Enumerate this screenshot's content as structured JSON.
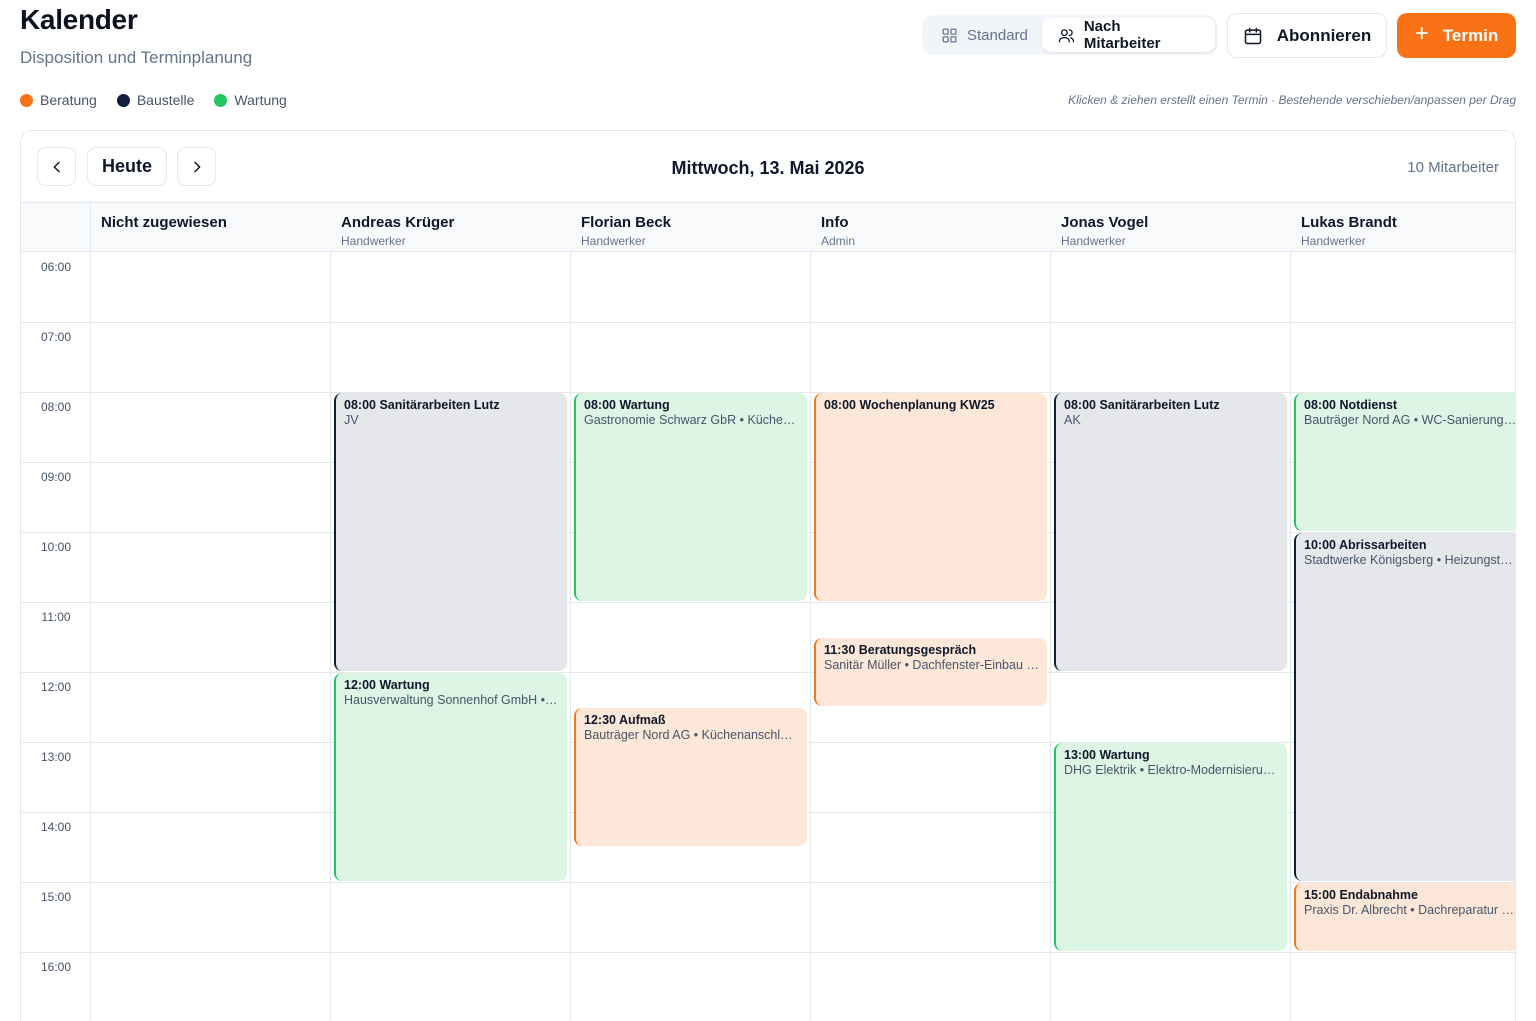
{
  "header": {
    "title": "Kalender",
    "subtitle": "Disposition und Terminplanung"
  },
  "view_toggle": {
    "standard_label": "Standard",
    "by_employee_label": "Nach Mitarbeiter",
    "active": "Nach Mitarbeiter"
  },
  "actions": {
    "subscribe_label": "Abonnieren",
    "new_label": "Termin"
  },
  "legend": [
    {
      "label": "Beratung",
      "color": "#f97316"
    },
    {
      "label": "Baustelle",
      "color": "#0f1f3d"
    },
    {
      "label": "Wartung",
      "color": "#22c55e"
    }
  ],
  "hint": "Klicken & ziehen erstellt einen Termin · Bestehende verschieben/anpassen per Drag",
  "calendar": {
    "today_label": "Heute",
    "date": "Mittwoch, 13. Mai 2026",
    "employee_count": "10 Mitarbeiter",
    "hours": [
      "06:00",
      "07:00",
      "08:00",
      "09:00",
      "10:00",
      "11:00",
      "12:00",
      "13:00",
      "14:00",
      "15:00",
      "16:00"
    ],
    "columns": [
      {
        "name": "Nicht zugewiesen",
        "role": ""
      },
      {
        "name": "Andreas Krüger",
        "role": "Handwerker"
      },
      {
        "name": "Florian Beck",
        "role": "Handwerker"
      },
      {
        "name": "Info",
        "role": "Admin"
      },
      {
        "name": "Jonas Vogel",
        "role": "Handwerker"
      },
      {
        "name": "Lukas Brandt",
        "role": "Handwerker"
      }
    ],
    "events": [
      {
        "column": 1,
        "start": 8,
        "end": 12,
        "type": "baustelle",
        "title": "08:00 Sanitärarbeiten Lutz",
        "subtitle": "JV"
      },
      {
        "column": 1,
        "start": 12,
        "end": 15,
        "type": "wartung",
        "title": "12:00 Wartung",
        "subtitle": "Hausverwaltung Sonnenhof GmbH • …"
      },
      {
        "column": 2,
        "start": 8,
        "end": 11,
        "type": "wartung",
        "title": "08:00 Wartung",
        "subtitle": "Gastronomie Schwarz GbR • Küchena…"
      },
      {
        "column": 2,
        "start": 12.5,
        "end": 14.5,
        "type": "beratung",
        "title": "12:30 Aufmaß",
        "subtitle": "Bauträger Nord AG • Küchenanschlus…"
      },
      {
        "column": 3,
        "start": 8,
        "end": 11,
        "type": "beratung",
        "title": "08:00 Wochenplanung KW25",
        "subtitle": ""
      },
      {
        "column": 3,
        "start": 11.5,
        "end": 12.5,
        "type": "beratung",
        "title": "11:30 Beratungsgespräch",
        "subtitle": "Sanitär Müller • Dachfenster-Einbau S…"
      },
      {
        "column": 4,
        "start": 8,
        "end": 12,
        "type": "baustelle",
        "title": "08:00 Sanitärarbeiten Lutz",
        "subtitle": "AK"
      },
      {
        "column": 4,
        "start": 13,
        "end": 16,
        "type": "wartung",
        "title": "13:00 Wartung",
        "subtitle": "DHG Elektrik • Elektro-Modernisierun…"
      },
      {
        "column": 5,
        "start": 8,
        "end": 10,
        "type": "wartung",
        "title": "08:00 Notdienst",
        "subtitle": "Bauträger Nord AG • WC-Sanierung …"
      },
      {
        "column": 5,
        "start": 10,
        "end": 15,
        "type": "baustelle",
        "title": "10:00 Abrissarbeiten",
        "subtitle": "Stadtwerke Königsberg • Heizungstau…"
      },
      {
        "column": 5,
        "start": 15,
        "end": 16,
        "type": "beratung",
        "title": "15:00 Endabnahme",
        "subtitle": "Praxis Dr. Albrecht • Dachreparatur El…"
      }
    ]
  }
}
